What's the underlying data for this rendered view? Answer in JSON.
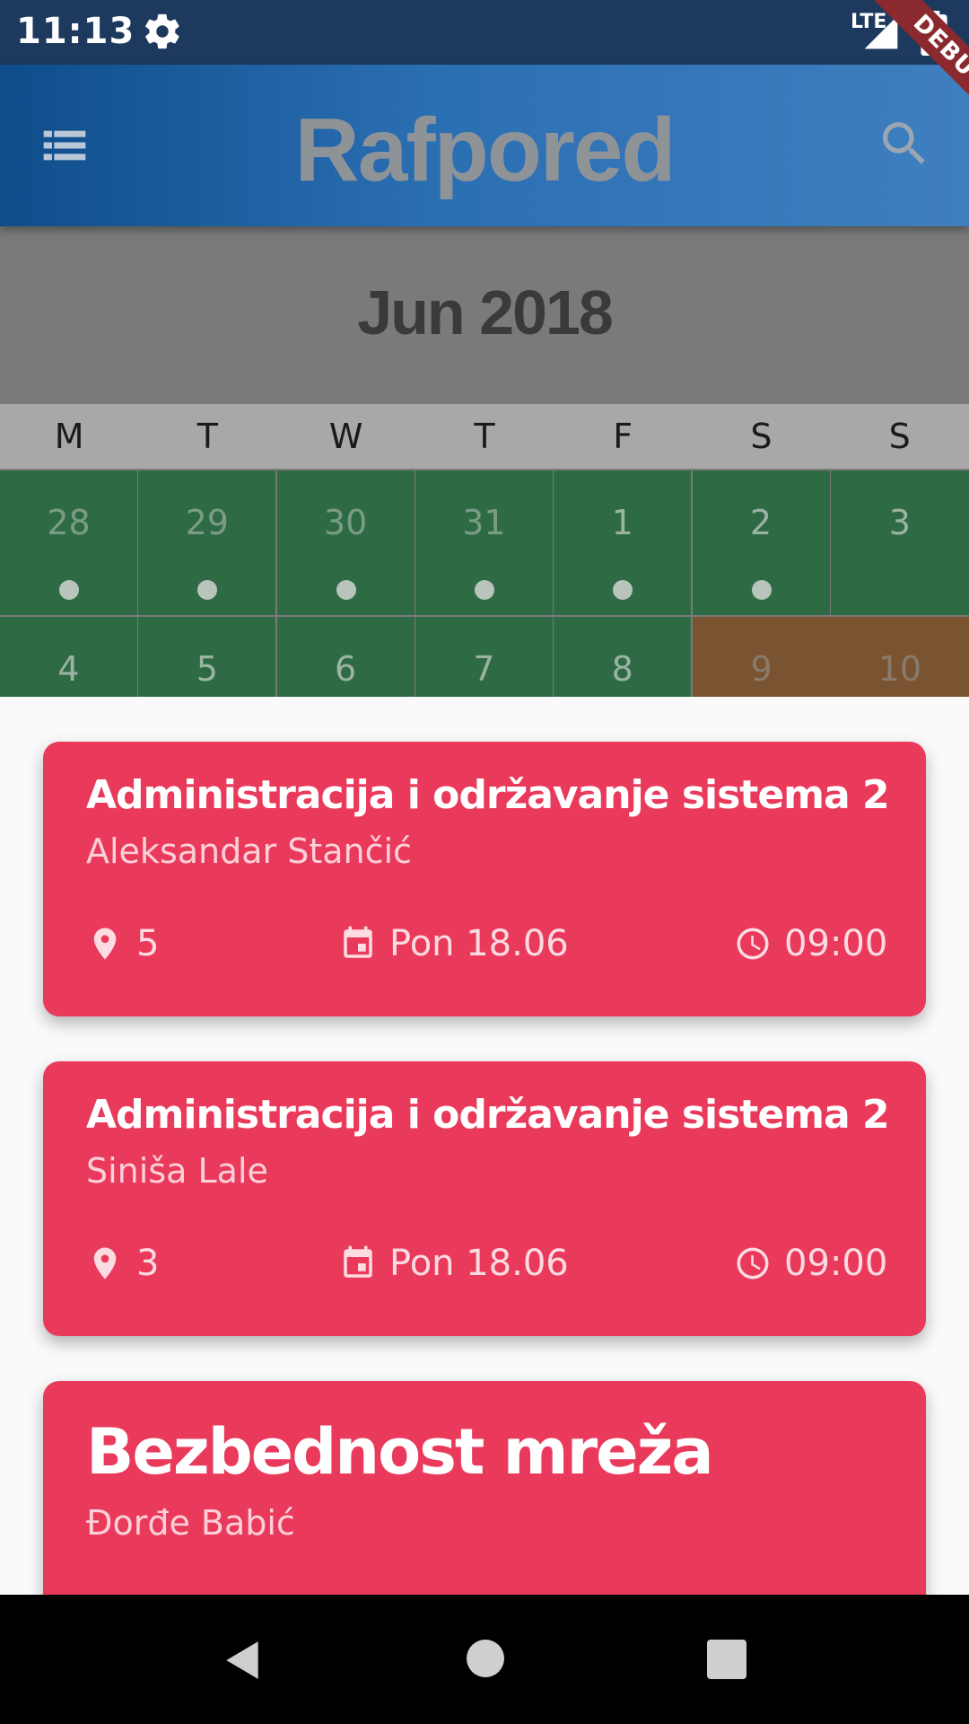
{
  "status": {
    "time": "11:13",
    "network": "LTE"
  },
  "app": {
    "title": "Rafpored",
    "debug_label": "DEBUG"
  },
  "calendar": {
    "month": "Jun 2018",
    "weekdays": [
      "M",
      "T",
      "W",
      "T",
      "F",
      "S",
      "S"
    ],
    "week1": [
      "28",
      "29",
      "30",
      "31",
      "1",
      "2",
      "3"
    ],
    "week2": [
      "4",
      "5",
      "6",
      "7",
      "8",
      "9",
      "10"
    ]
  },
  "events": [
    {
      "title": "Administracija i održavanje sistema 2",
      "lecturer": "Aleksandar Stančić",
      "room": "5",
      "date": "Pon 18.06",
      "time": "09:00"
    },
    {
      "title": "Administracija i održavanje sistema 2",
      "lecturer": "Siniša Lale",
      "room": "3",
      "date": "Pon 18.06",
      "time": "09:00"
    },
    {
      "title": "Bezbednost mreža",
      "lecturer": "Đorđe Babić"
    }
  ],
  "colors": {
    "accent": "#ea3a5c",
    "app_bar": "#2b6fb3",
    "day_green": "#2e6b45",
    "day_orange": "#7a5430"
  },
  "icons": [
    "gear-icon",
    "signal-icon",
    "battery-icon",
    "menu-list-icon",
    "search-icon",
    "location-pin-icon",
    "calendar-icon",
    "clock-icon",
    "back-icon",
    "home-icon",
    "recents-icon"
  ]
}
